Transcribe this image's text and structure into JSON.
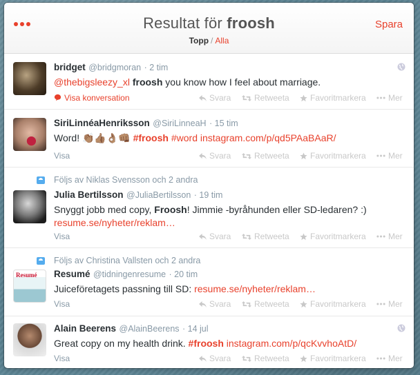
{
  "header": {
    "title_prefix": "Resultat för",
    "query": "froosh",
    "save_label": "Spara",
    "tab_top": "Topp",
    "tab_sep": "/",
    "tab_all": "Alla"
  },
  "action_labels": {
    "reply": "Svara",
    "retweet": "Retweeta",
    "favorite": "Favoritmarkera",
    "more": "Mer"
  },
  "tweets": [
    {
      "name": "bridget",
      "handle": "@bridgmoran",
      "time": "· 2 tim",
      "text_parts": [
        "@thebigsleezy_xl",
        "froosh",
        "you know how I feel about marriage."
      ],
      "footer": "Visa konversation"
    },
    {
      "name": "SiriLinnéaHenriksson",
      "handle": "@SiriLinneaH",
      "time": "· 15 tim",
      "text_parts": [
        "Word!",
        "👏🏽👍🏽👌🏽👊🏽",
        "#froosh",
        "#word",
        "instagram.com/p/qd5PAaBAaR/"
      ],
      "footer": "Visa"
    },
    {
      "context": "Följs av Niklas Svensson och 2 andra",
      "name": "Julia Bertilsson",
      "handle": "@JuliaBertilsson",
      "time": "· 19 tim",
      "text_parts": [
        "Snyggt jobb med copy,",
        "Froosh",
        "! Jimmie -byråhunden eller SD-ledaren? :)",
        "resume.se/nyheter/reklam…"
      ],
      "footer": "Visa"
    },
    {
      "context": "Följs av Christina Vallsten och 2 andra",
      "name": "Resumé",
      "handle": "@tidningenresume",
      "time": "· 20 tim",
      "text_parts": [
        "Juiceföretagets passning till SD:",
        "resume.se/nyheter/reklam…"
      ],
      "footer": "Visa",
      "avatar_text": "Resumé"
    },
    {
      "name": "Alain Beerens",
      "handle": "@AlainBeerens",
      "time": "· 14 jul",
      "text_parts": [
        "Great copy on my health drink.",
        "#froosh",
        "instagram.com/p/qcKvvhoAtD/"
      ],
      "footer": "Visa"
    }
  ],
  "colors": {
    "accent": "#e8412c",
    "muted": "#8899a6",
    "text": "#292f33",
    "context_icon": "#55acee"
  },
  "icons": [
    "more-dots-icon",
    "globe-icon",
    "speech-bubble-icon",
    "reply-icon",
    "retweet-icon",
    "star-icon",
    "more-icon",
    "person-card-icon"
  ]
}
